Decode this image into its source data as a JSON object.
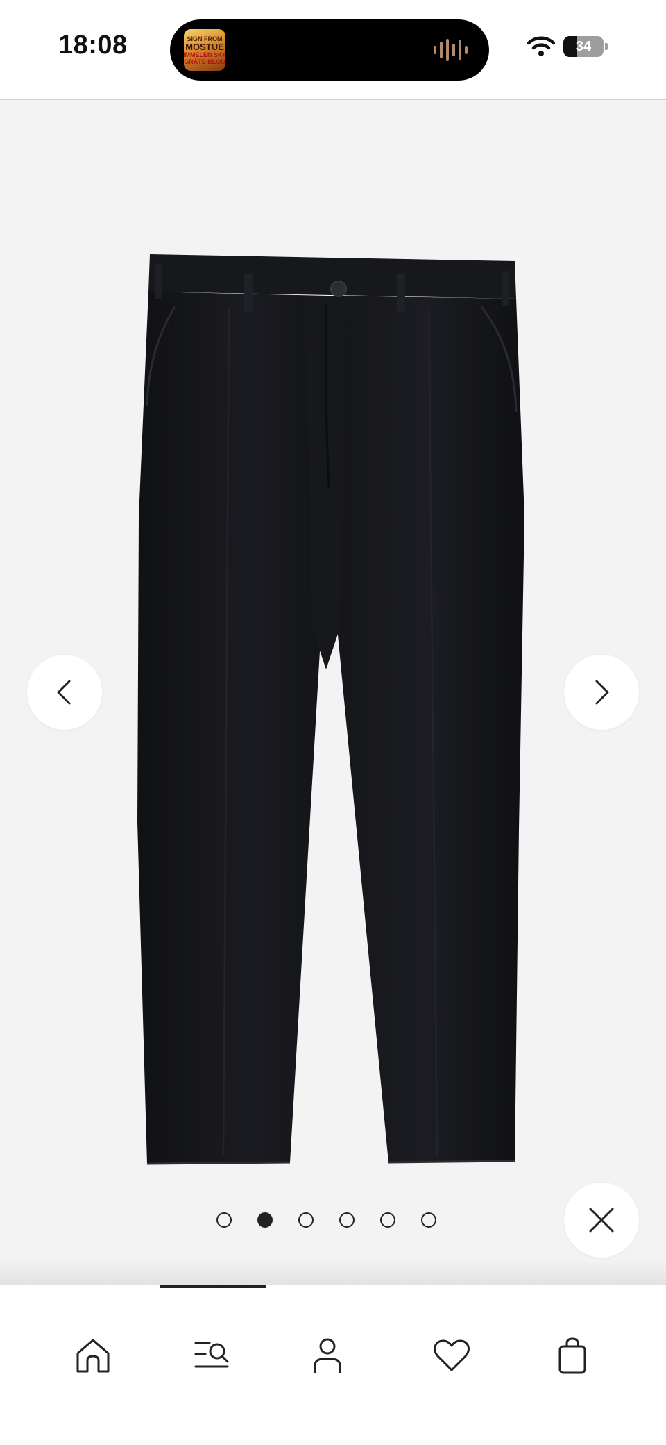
{
  "status_bar": {
    "time": "18:08",
    "battery_percent": "34",
    "battery_level": 0.34,
    "now_playing_artwork": {
      "line1": "SIGN FROM",
      "line2": "MOSTUE",
      "line3": "HIMMELEN SKAL",
      "line4": "GRÅTE BLOD"
    }
  },
  "gallery": {
    "image_count": 6,
    "active_index": 1,
    "product_color": "#16171b",
    "background_color": "#f3f3f3",
    "prev_icon": "chevron-left-icon",
    "next_icon": "chevron-right-icon",
    "close_icon": "close-icon"
  },
  "bottom_nav": {
    "active_item": "search",
    "items": [
      {
        "id": "home",
        "icon": "home-icon"
      },
      {
        "id": "search",
        "icon": "search-menu-icon"
      },
      {
        "id": "account",
        "icon": "user-icon"
      },
      {
        "id": "favorites",
        "icon": "heart-icon"
      },
      {
        "id": "bag",
        "icon": "shopping-bag-icon"
      }
    ]
  }
}
